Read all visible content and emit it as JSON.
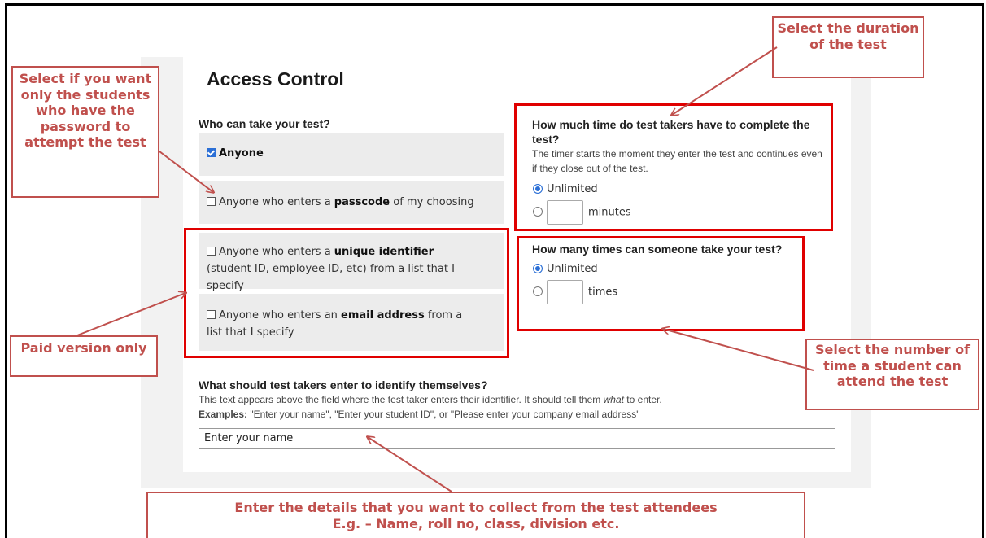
{
  "page": {
    "title": "Access Control"
  },
  "who": {
    "heading": "Who can take your test?",
    "options": [
      {
        "checked": true,
        "pre": "",
        "bold": "Anyone",
        "post": ""
      },
      {
        "checked": false,
        "pre": "Anyone who enters a ",
        "bold": "passcode",
        "post": " of my choosing"
      },
      {
        "checked": false,
        "pre": "Anyone who enters a ",
        "bold": "unique identifier",
        "post": " (student ID, employee ID, etc) from a list that I specify"
      },
      {
        "checked": false,
        "pre": "Anyone who enters an ",
        "bold": "email address",
        "post": " from a list that I specify"
      }
    ]
  },
  "time": {
    "heading": "How much time do test takers have to complete the test?",
    "desc": "The timer starts the moment they enter the test and continues even if they close out of the test.",
    "unlimited_label": "Unlimited",
    "unit_label": "minutes"
  },
  "attempts": {
    "heading": "How many times can someone take your test?",
    "unlimited_label": "Unlimited",
    "unit_label": "times"
  },
  "identify": {
    "heading": "What should test takers enter to identify themselves?",
    "desc_pre": "This text appears above the field where the test taker enters their identifier. It should tell them ",
    "desc_em": "what",
    "desc_post": " to enter.",
    "examples_label": "Examples:",
    "examples_text": " \"Enter your name\", \"Enter your student ID\", or \"Please enter your company email address\"",
    "input_value": "Enter your name"
  },
  "callouts": {
    "password": "Select if you want only the students who have the password to attempt the test",
    "duration": "Select the duration of the test",
    "paid": "Paid version only",
    "attempts": "Select the number of time a student can attend the test",
    "details_line1": "Enter the details that you want to collect from the test attendees",
    "details_line2": "E.g. – Name, roll no, class, division etc."
  },
  "colors": {
    "highlight_box": "#e00000",
    "callout": "#c0504d",
    "accent": "#2b6fd6"
  }
}
